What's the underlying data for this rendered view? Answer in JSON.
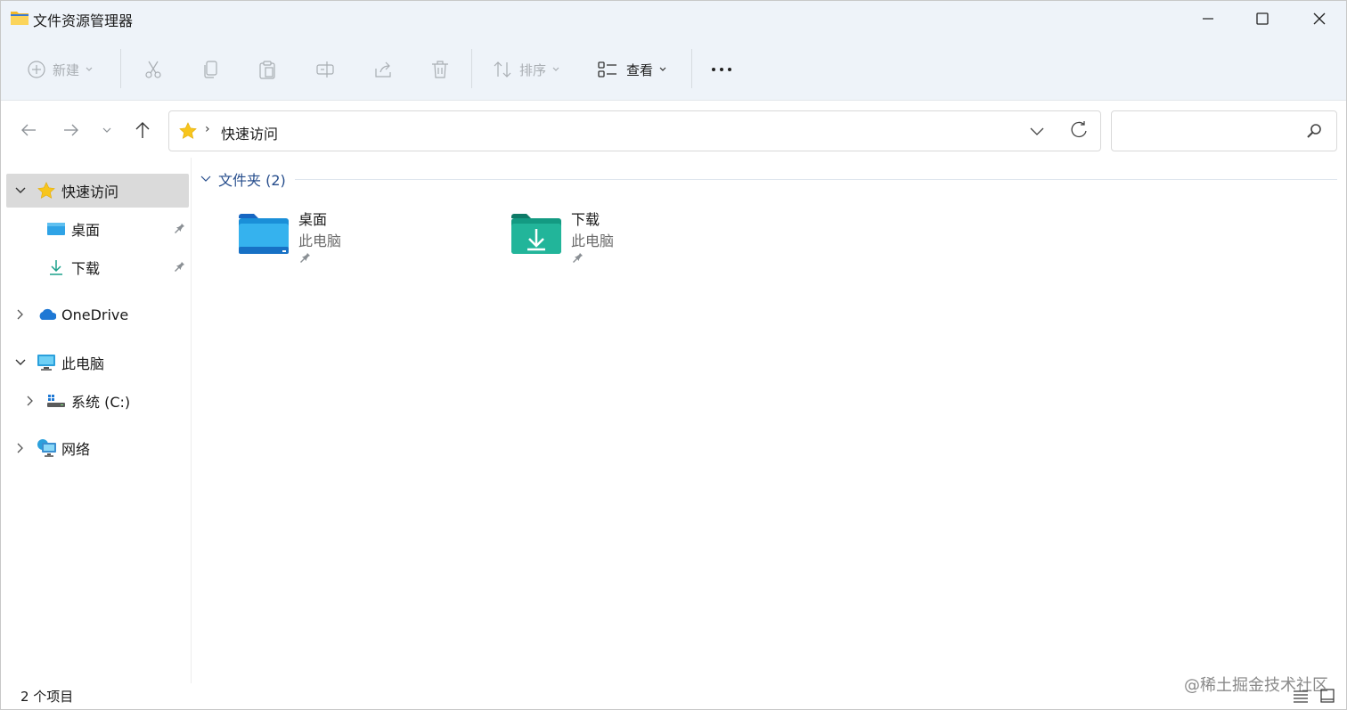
{
  "window": {
    "title": "文件资源管理器"
  },
  "commandbar": {
    "new_label": "新建",
    "sort_label": "排序",
    "view_label": "查看",
    "more_icon": "more-icon"
  },
  "address": {
    "location": "快速访问",
    "search_placeholder": ""
  },
  "sidebar": {
    "items": [
      {
        "label": "快速访问",
        "icon": "star-icon",
        "selected": true
      },
      {
        "label": "桌面",
        "icon": "desktop-icon",
        "pinned": true
      },
      {
        "label": "下载",
        "icon": "download-icon",
        "pinned": true
      },
      {
        "label": "OneDrive",
        "icon": "onedrive-icon"
      },
      {
        "label": "此电脑",
        "icon": "computer-icon"
      },
      {
        "label": "系统 (C:)",
        "icon": "drive-icon"
      },
      {
        "label": "网络",
        "icon": "network-icon"
      }
    ]
  },
  "content": {
    "group_title": "文件夹 (2)",
    "folders": [
      {
        "name": "桌面",
        "location": "此电脑",
        "pinned": true,
        "icon": "desktop-folder-icon"
      },
      {
        "name": "下载",
        "location": "此电脑",
        "pinned": true,
        "icon": "downloads-folder-icon"
      }
    ]
  },
  "statusbar": {
    "item_count": "2 个项目",
    "watermark": "@稀土掘金技术社区"
  },
  "colors": {
    "chrome_bg": "#eef3f9",
    "selected_bg": "#dadada",
    "group_title": "#264d8c",
    "folder_blue": "#1a8fd8",
    "folder_green": "#1aa08a",
    "star_yellow": "#f7c51d"
  }
}
